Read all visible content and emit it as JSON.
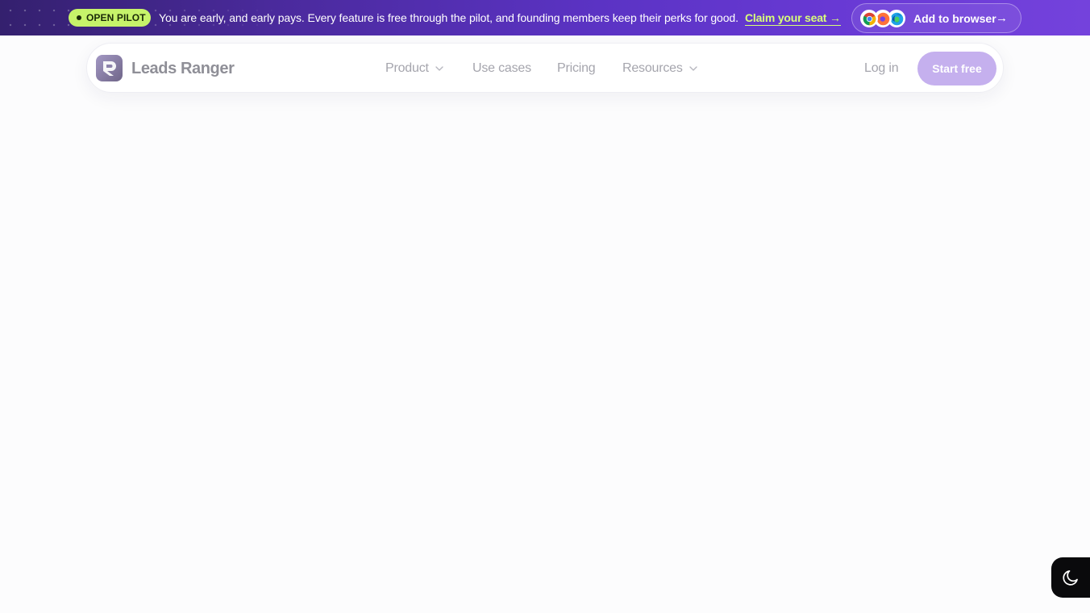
{
  "announcement": {
    "badge": "OPEN PILOT",
    "message": "You are early, and early pays. Every feature is free through the pilot, and founding members keep their perks for good.",
    "cta": "Claim your seat →",
    "browser_button": {
      "label": "Add to browser",
      "arrow": "→",
      "icons": [
        "chrome-icon",
        "firefox-icon",
        "edge-icon"
      ]
    }
  },
  "nav": {
    "brand": "Leads Ranger",
    "items": [
      {
        "label": "Product",
        "has_dropdown": true
      },
      {
        "label": "Use cases",
        "has_dropdown": false
      },
      {
        "label": "Pricing",
        "has_dropdown": false
      },
      {
        "label": "Resources",
        "has_dropdown": true
      }
    ],
    "login": "Log in",
    "cta": "Start free"
  },
  "theme_toggle": {
    "icon": "moon-icon"
  },
  "colors": {
    "accent": "#6a3ad6",
    "badge_bg": "#c6f36a",
    "link": "#d7ff7a",
    "cta_bg": "#c5b0ee",
    "page_bg": "#fcfcfd"
  }
}
